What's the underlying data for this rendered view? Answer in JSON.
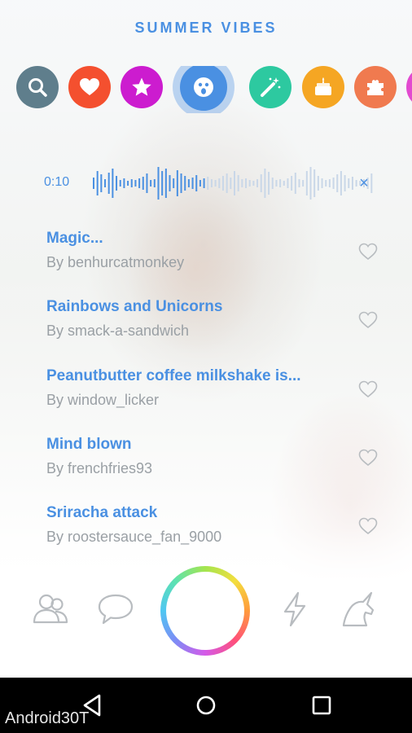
{
  "header": {
    "title": "SUMMER VIBES"
  },
  "categories": [
    {
      "icon": "search-icon",
      "color": "#5f7e8c"
    },
    {
      "icon": "heart-icon",
      "color": "#f4502f"
    },
    {
      "icon": "star-icon",
      "color": "#cc1ccf"
    },
    {
      "icon": "surprised-face-icon",
      "color": "#4a90e2",
      "selected": true
    },
    {
      "icon": "magic-wand-icon",
      "color": "#2dc9a0"
    },
    {
      "icon": "cake-icon",
      "color": "#f5a623"
    },
    {
      "icon": "puzzle-icon",
      "color": "#f07a4f"
    },
    {
      "icon": "partial-category-icon",
      "color": "#e24ad0"
    }
  ],
  "player": {
    "time": "0:10",
    "close_label": "×",
    "progress": 0.4
  },
  "sounds": [
    {
      "title": "Magic...",
      "author": "By benhurcatmonkey"
    },
    {
      "title": "Rainbows and Unicorns",
      "author": "By smack-a-sandwich"
    },
    {
      "title": "Peanutbutter coffee milkshake is...",
      "author": "By window_licker"
    },
    {
      "title": "Mind blown",
      "author": "By frenchfries93"
    },
    {
      "title": "Sriracha attack",
      "author": "By roostersauce_fan_9000"
    }
  ],
  "bottom_nav": [
    {
      "icon": "friends-icon"
    },
    {
      "icon": "chat-bubble-icon"
    },
    {
      "icon": "record-button"
    },
    {
      "icon": "lightning-icon"
    },
    {
      "icon": "unicorn-icon"
    }
  ],
  "system_nav": [
    {
      "icon": "back-icon"
    },
    {
      "icon": "home-icon"
    },
    {
      "icon": "recents-icon"
    }
  ],
  "watermark": "Android30T",
  "colors": {
    "accent": "#4a90e2",
    "secondary_text": "#9aa0a5",
    "icon_gray": "#b8bcc0"
  }
}
